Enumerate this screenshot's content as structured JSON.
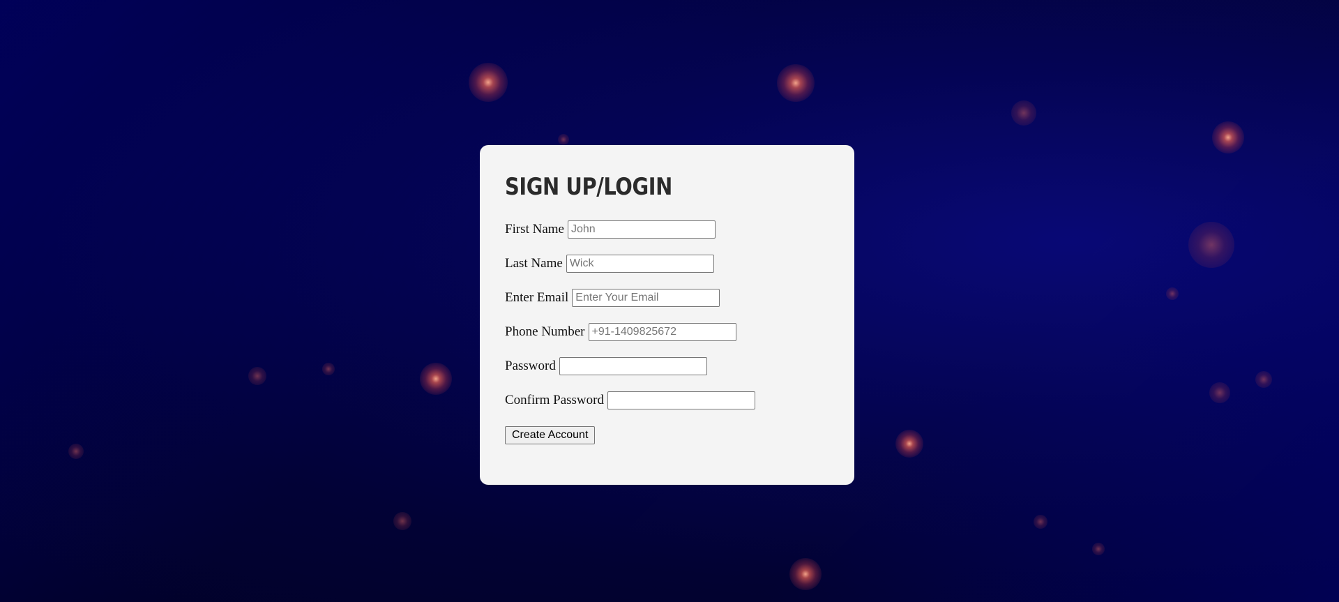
{
  "form": {
    "title": "SIGN UP/LOGIN",
    "fields": {
      "first_name": {
        "label": "First Name",
        "placeholder": "John",
        "value": ""
      },
      "last_name": {
        "label": "Last Name",
        "placeholder": "Wick",
        "value": ""
      },
      "email": {
        "label": "Enter Email",
        "placeholder": "Enter Your Email",
        "value": ""
      },
      "phone": {
        "label": "Phone Number",
        "placeholder": "+91-1409825672",
        "value": ""
      },
      "password": {
        "label": "Password",
        "placeholder": "",
        "value": ""
      },
      "confirm_password": {
        "label": "Confirm Password",
        "placeholder": "",
        "value": ""
      }
    },
    "submit_label": "Create Account"
  },
  "colors": {
    "card_background": "#f4f4f4",
    "page_background": "#03035a",
    "orb_color": "#e0504f"
  }
}
